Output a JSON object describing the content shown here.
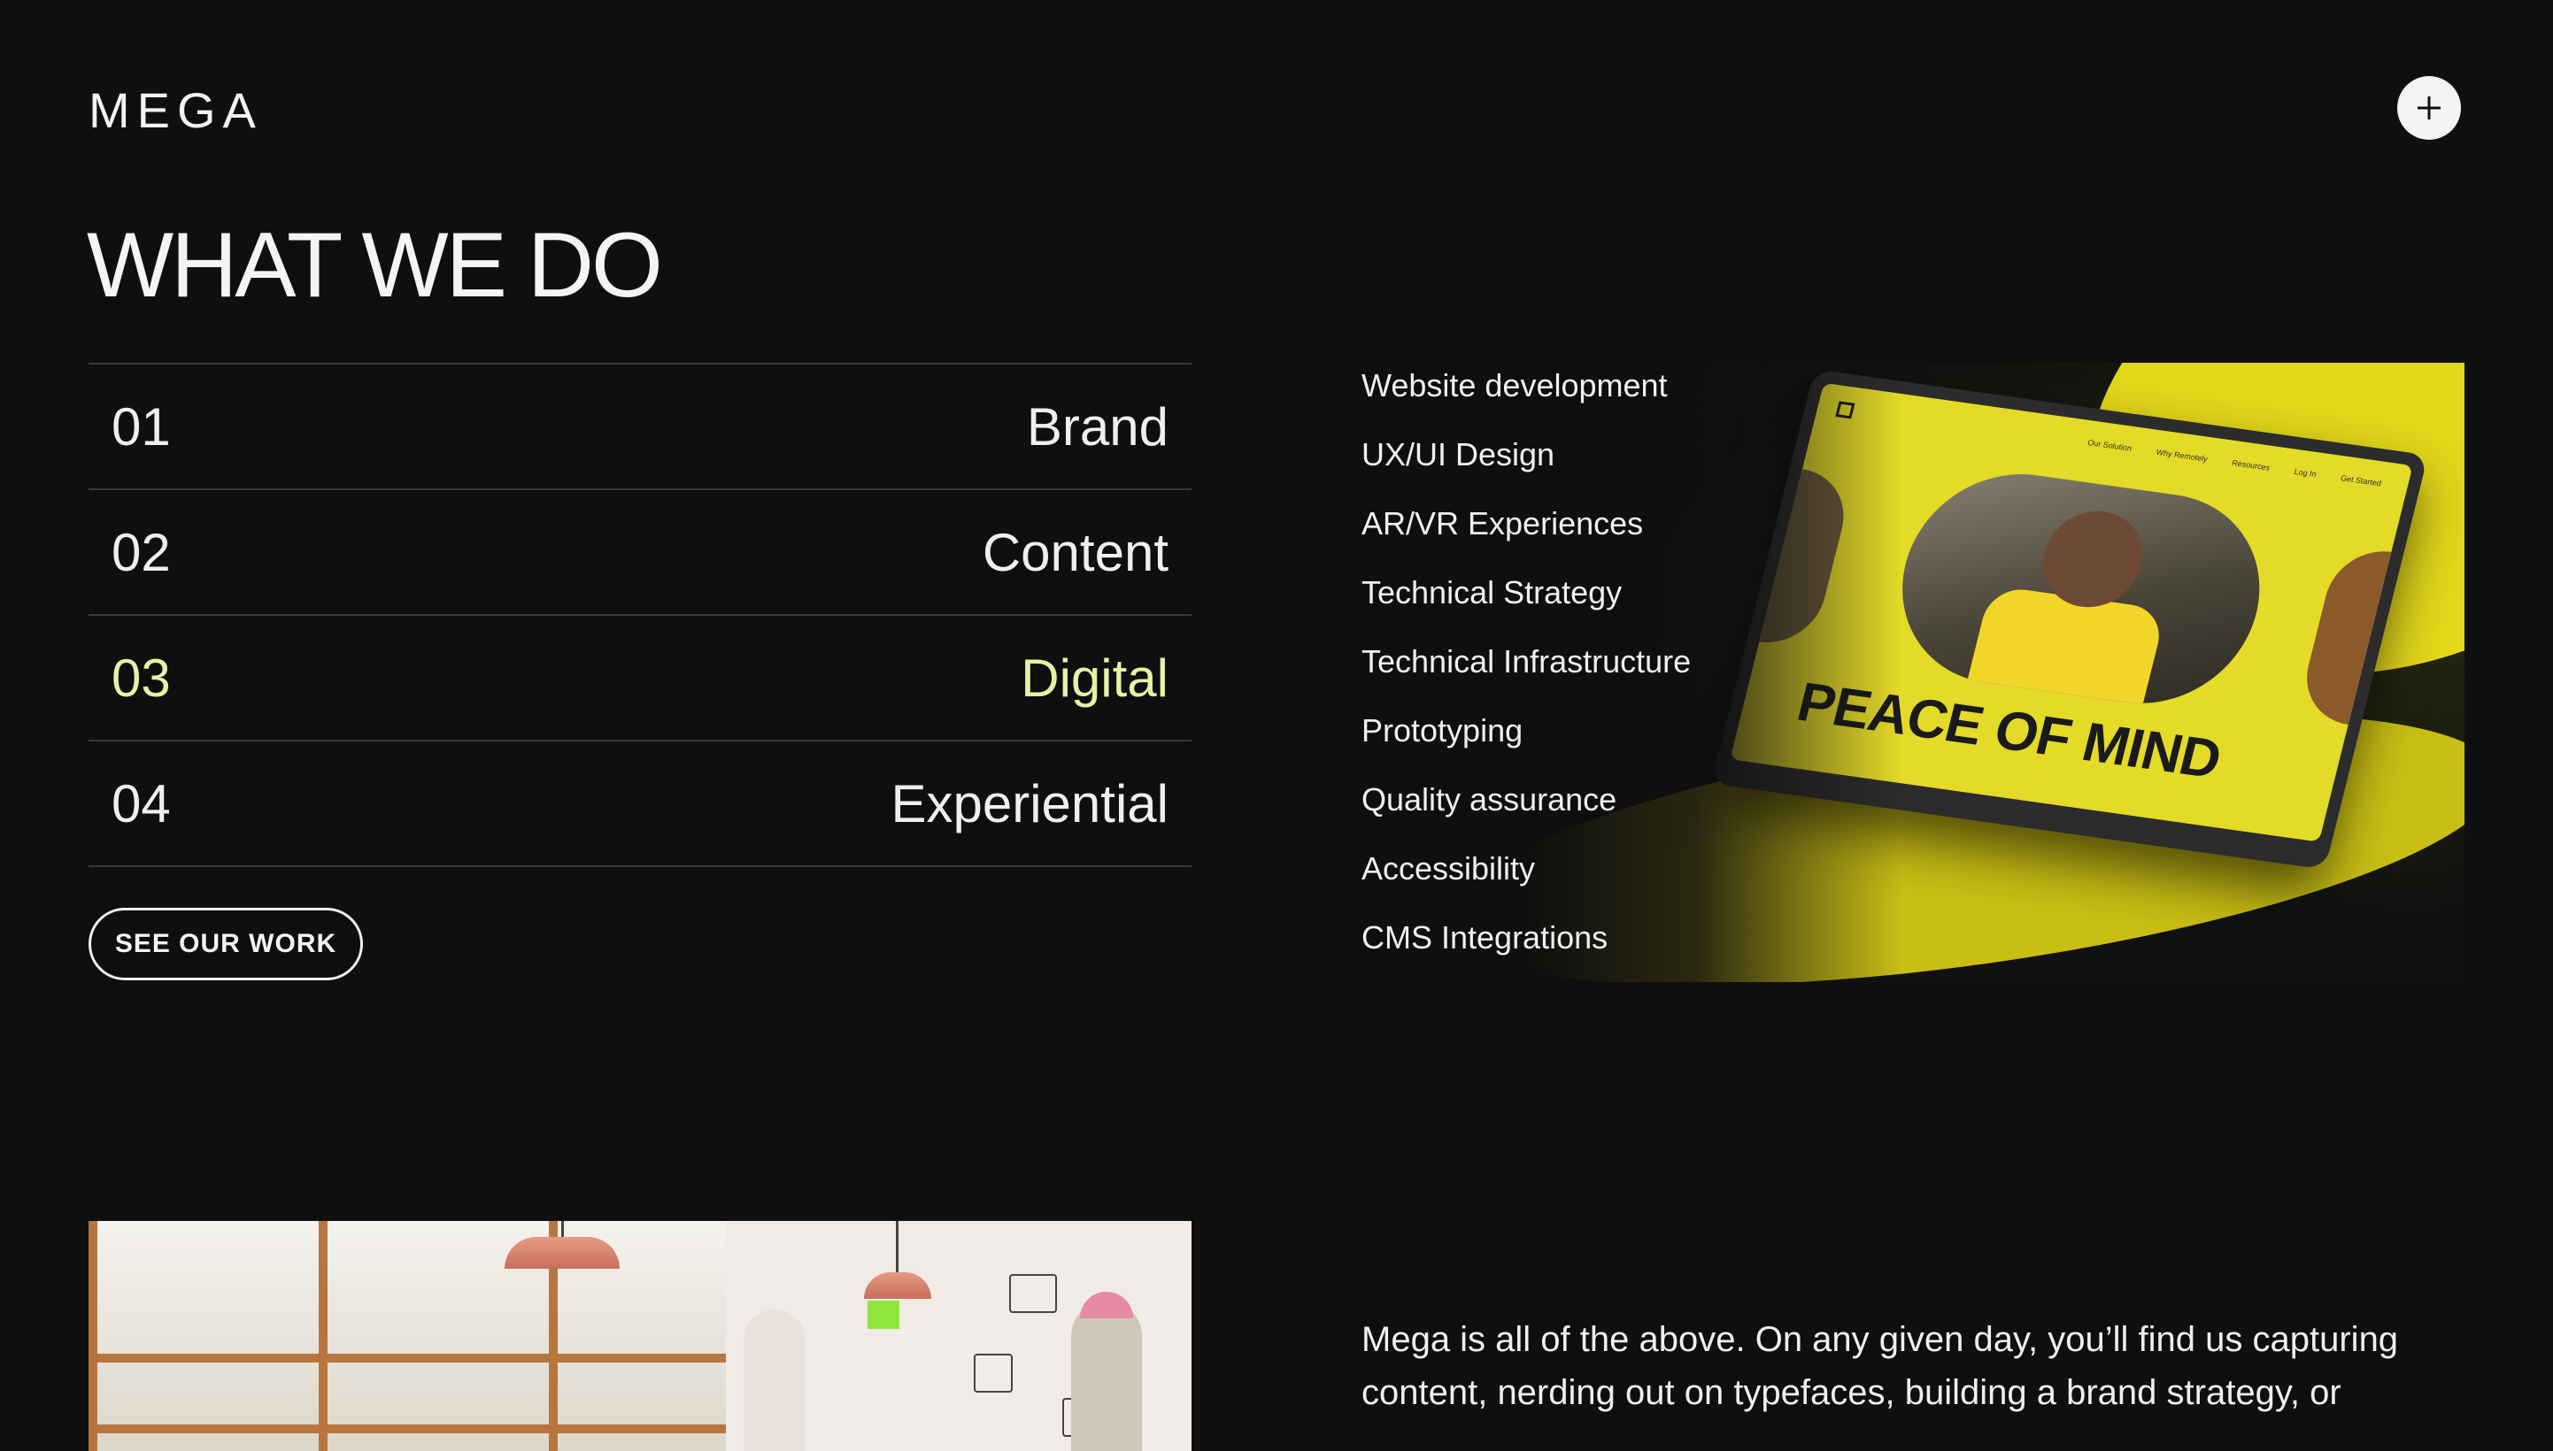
{
  "header": {
    "logo": "MEGA",
    "menu_icon": "plus-icon"
  },
  "page_title": "WHAT WE DO",
  "services": [
    {
      "number": "01",
      "label": "Brand",
      "active": false
    },
    {
      "number": "02",
      "label": "Content",
      "active": false
    },
    {
      "number": "03",
      "label": "Digital",
      "active": true
    },
    {
      "number": "04",
      "label": "Experiential",
      "active": false
    }
  ],
  "cta_label": "SEE OUR WORK",
  "capabilities": [
    "Website development",
    "UX/UI Design",
    "AR/VR Experiences",
    "Technical Strategy",
    "Technical Infrastructure",
    "Prototyping",
    "Quality assurance",
    "Accessibility",
    "CMS Integrations"
  ],
  "feature_image": {
    "headline": "PEACE OF MIND",
    "nav_items": [
      "Our Solution",
      "Why Remotely",
      "Resources",
      "Log In",
      "Get Started"
    ]
  },
  "about": {
    "text": "Mega is all of the above. On any given day, you’ll find us capturing content, nerding out on typefaces, building a brand strategy, or"
  },
  "colors": {
    "background": "#0f0f0f",
    "text": "#ededed",
    "active_accent": "#e9f1a6",
    "divider": "#3a3a3a",
    "brand_yellow": "#e3d71a"
  }
}
